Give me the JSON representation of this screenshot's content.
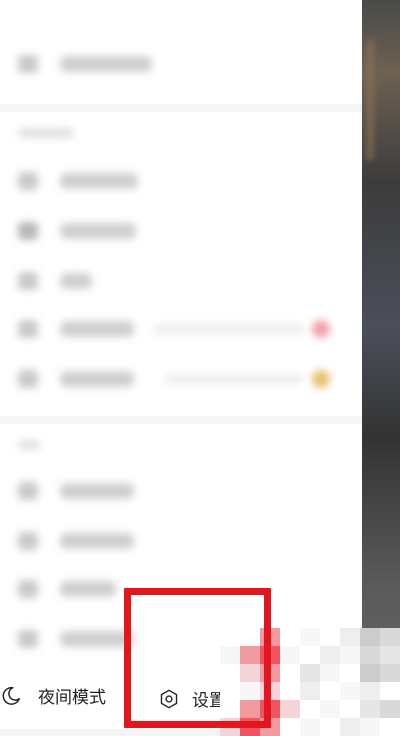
{
  "drawer": {
    "bottom_actions": {
      "night_mode": {
        "label": "夜间模式",
        "icon": "moon-icon"
      },
      "settings": {
        "label": "设置",
        "icon": "gear-icon"
      }
    }
  },
  "highlight": {
    "color": "#e2161c"
  }
}
